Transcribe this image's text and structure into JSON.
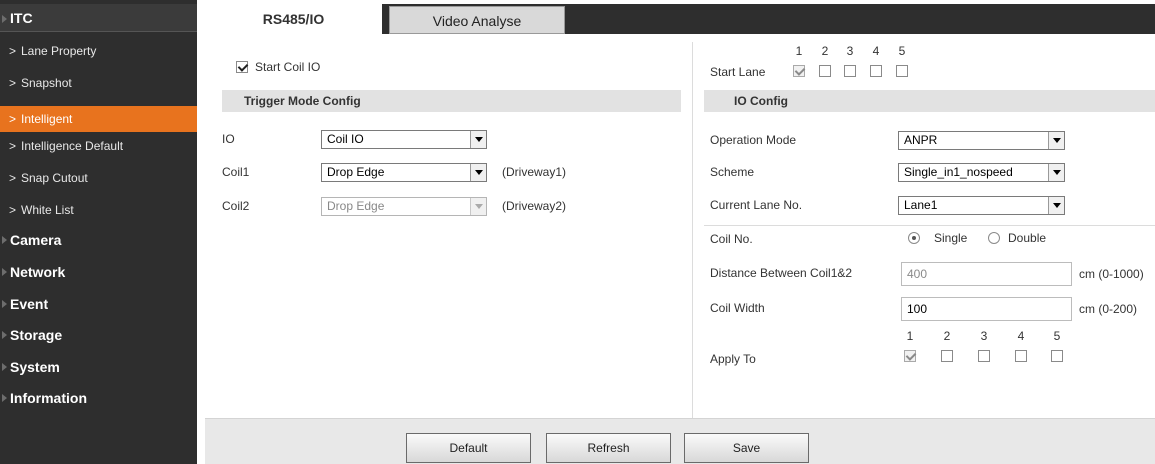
{
  "sidebar": {
    "itc": "ITC",
    "items": [
      {
        "label": "Lane Property"
      },
      {
        "label": "Snapshot"
      },
      {
        "label": "Intelligent"
      },
      {
        "label": "Intelligence Default"
      },
      {
        "label": "Snap Cutout"
      },
      {
        "label": "White List"
      }
    ],
    "groups": [
      "Camera",
      "Network",
      "Event",
      "Storage",
      "System",
      "Information"
    ]
  },
  "tabs": [
    "RS485/IO",
    "Video Analyse"
  ],
  "left": {
    "start_coil_io": "Start Coil IO",
    "trigger_header": "Trigger Mode Config",
    "io_label": "IO",
    "io_value": "Coil IO",
    "coil1_label": "Coil1",
    "coil1_value": "Drop Edge",
    "coil1_note": "(Driveway1)",
    "coil2_label": "Coil2",
    "coil2_value": "Drop Edge",
    "coil2_note": "(Driveway2)"
  },
  "right": {
    "start_lane": "Start Lane",
    "lane_numbers": [
      "1",
      "2",
      "3",
      "4",
      "5"
    ],
    "io_header": "IO Config",
    "operation_mode_label": "Operation Mode",
    "operation_mode_value": "ANPR",
    "scheme_label": "Scheme",
    "scheme_value": "Single_in1_nospeed",
    "current_lane_label": "Current Lane No.",
    "current_lane_value": "Lane1",
    "coil_no_label": "Coil No.",
    "coil_single": "Single",
    "coil_double": "Double",
    "distance_label": "Distance Between Coil1&2",
    "distance_value": "400",
    "distance_unit": "cm (0-1000)",
    "coil_width_label": "Coil Width",
    "coil_width_value": "100",
    "coil_width_unit": "cm (0-200)",
    "apply_to_label": "Apply To"
  },
  "footer": {
    "default": "Default",
    "refresh": "Refresh",
    "save": "Save"
  },
  "colors": {
    "sidebar_bg": "#2e2e2e",
    "active_item": "#e8731e"
  }
}
